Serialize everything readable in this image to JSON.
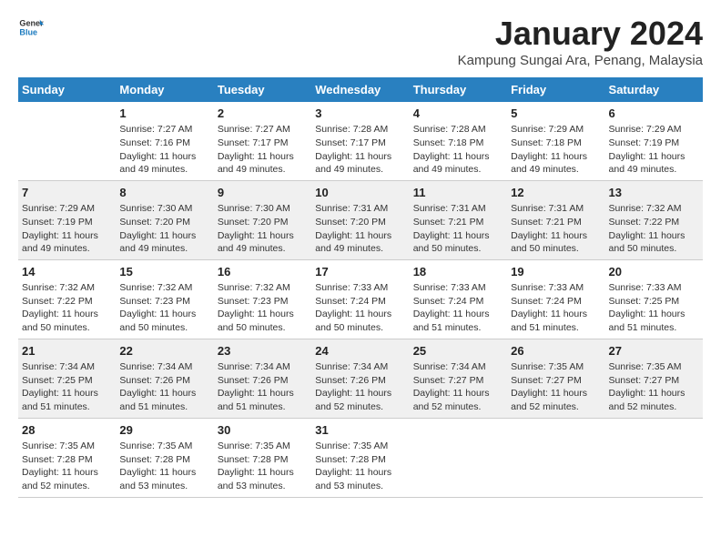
{
  "header": {
    "logo_line1": "General",
    "logo_line2": "Blue",
    "month": "January 2024",
    "location": "Kampung Sungai Ara, Penang, Malaysia"
  },
  "weekdays": [
    "Sunday",
    "Monday",
    "Tuesday",
    "Wednesday",
    "Thursday",
    "Friday",
    "Saturday"
  ],
  "weeks": [
    [
      {
        "day": "",
        "info": ""
      },
      {
        "day": "1",
        "info": "Sunrise: 7:27 AM\nSunset: 7:16 PM\nDaylight: 11 hours and 49 minutes."
      },
      {
        "day": "2",
        "info": "Sunrise: 7:27 AM\nSunset: 7:17 PM\nDaylight: 11 hours and 49 minutes."
      },
      {
        "day": "3",
        "info": "Sunrise: 7:28 AM\nSunset: 7:17 PM\nDaylight: 11 hours and 49 minutes."
      },
      {
        "day": "4",
        "info": "Sunrise: 7:28 AM\nSunset: 7:18 PM\nDaylight: 11 hours and 49 minutes."
      },
      {
        "day": "5",
        "info": "Sunrise: 7:29 AM\nSunset: 7:18 PM\nDaylight: 11 hours and 49 minutes."
      },
      {
        "day": "6",
        "info": "Sunrise: 7:29 AM\nSunset: 7:19 PM\nDaylight: 11 hours and 49 minutes."
      }
    ],
    [
      {
        "day": "7",
        "info": "Sunrise: 7:29 AM\nSunset: 7:19 PM\nDaylight: 11 hours and 49 minutes."
      },
      {
        "day": "8",
        "info": "Sunrise: 7:30 AM\nSunset: 7:20 PM\nDaylight: 11 hours and 49 minutes."
      },
      {
        "day": "9",
        "info": "Sunrise: 7:30 AM\nSunset: 7:20 PM\nDaylight: 11 hours and 49 minutes."
      },
      {
        "day": "10",
        "info": "Sunrise: 7:31 AM\nSunset: 7:20 PM\nDaylight: 11 hours and 49 minutes."
      },
      {
        "day": "11",
        "info": "Sunrise: 7:31 AM\nSunset: 7:21 PM\nDaylight: 11 hours and 50 minutes."
      },
      {
        "day": "12",
        "info": "Sunrise: 7:31 AM\nSunset: 7:21 PM\nDaylight: 11 hours and 50 minutes."
      },
      {
        "day": "13",
        "info": "Sunrise: 7:32 AM\nSunset: 7:22 PM\nDaylight: 11 hours and 50 minutes."
      }
    ],
    [
      {
        "day": "14",
        "info": "Sunrise: 7:32 AM\nSunset: 7:22 PM\nDaylight: 11 hours and 50 minutes."
      },
      {
        "day": "15",
        "info": "Sunrise: 7:32 AM\nSunset: 7:23 PM\nDaylight: 11 hours and 50 minutes."
      },
      {
        "day": "16",
        "info": "Sunrise: 7:32 AM\nSunset: 7:23 PM\nDaylight: 11 hours and 50 minutes."
      },
      {
        "day": "17",
        "info": "Sunrise: 7:33 AM\nSunset: 7:24 PM\nDaylight: 11 hours and 50 minutes."
      },
      {
        "day": "18",
        "info": "Sunrise: 7:33 AM\nSunset: 7:24 PM\nDaylight: 11 hours and 51 minutes."
      },
      {
        "day": "19",
        "info": "Sunrise: 7:33 AM\nSunset: 7:24 PM\nDaylight: 11 hours and 51 minutes."
      },
      {
        "day": "20",
        "info": "Sunrise: 7:33 AM\nSunset: 7:25 PM\nDaylight: 11 hours and 51 minutes."
      }
    ],
    [
      {
        "day": "21",
        "info": "Sunrise: 7:34 AM\nSunset: 7:25 PM\nDaylight: 11 hours and 51 minutes."
      },
      {
        "day": "22",
        "info": "Sunrise: 7:34 AM\nSunset: 7:26 PM\nDaylight: 11 hours and 51 minutes."
      },
      {
        "day": "23",
        "info": "Sunrise: 7:34 AM\nSunset: 7:26 PM\nDaylight: 11 hours and 51 minutes."
      },
      {
        "day": "24",
        "info": "Sunrise: 7:34 AM\nSunset: 7:26 PM\nDaylight: 11 hours and 52 minutes."
      },
      {
        "day": "25",
        "info": "Sunrise: 7:34 AM\nSunset: 7:27 PM\nDaylight: 11 hours and 52 minutes."
      },
      {
        "day": "26",
        "info": "Sunrise: 7:35 AM\nSunset: 7:27 PM\nDaylight: 11 hours and 52 minutes."
      },
      {
        "day": "27",
        "info": "Sunrise: 7:35 AM\nSunset: 7:27 PM\nDaylight: 11 hours and 52 minutes."
      }
    ],
    [
      {
        "day": "28",
        "info": "Sunrise: 7:35 AM\nSunset: 7:28 PM\nDaylight: 11 hours and 52 minutes."
      },
      {
        "day": "29",
        "info": "Sunrise: 7:35 AM\nSunset: 7:28 PM\nDaylight: 11 hours and 53 minutes."
      },
      {
        "day": "30",
        "info": "Sunrise: 7:35 AM\nSunset: 7:28 PM\nDaylight: 11 hours and 53 minutes."
      },
      {
        "day": "31",
        "info": "Sunrise: 7:35 AM\nSunset: 7:28 PM\nDaylight: 11 hours and 53 minutes."
      },
      {
        "day": "",
        "info": ""
      },
      {
        "day": "",
        "info": ""
      },
      {
        "day": "",
        "info": ""
      }
    ]
  ]
}
